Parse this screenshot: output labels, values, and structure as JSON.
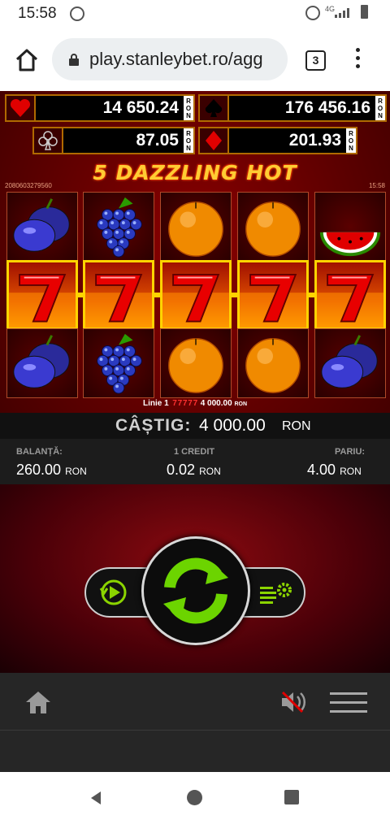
{
  "status_bar": {
    "time": "15:58",
    "network": "4G"
  },
  "browser": {
    "url": "play.stanleybet.ro/agg",
    "tab_count": "3"
  },
  "jackpots": [
    {
      "suit": "heart",
      "value": "14 650.24",
      "currency": "RON",
      "color": "#e00000"
    },
    {
      "suit": "spade",
      "value": "176 456.16",
      "currency": "RON",
      "color": "#000000"
    },
    {
      "suit": "club",
      "value": "87.05",
      "currency": "RON",
      "color": "#000000"
    },
    {
      "suit": "diamond",
      "value": "201.93",
      "currency": "RON",
      "color": "#e00000"
    }
  ],
  "game": {
    "title": "5 DAZZLING HOT",
    "id": "2080603279560",
    "clock": "15:58",
    "reels": [
      [
        "plum",
        "seven",
        "plum"
      ],
      [
        "grapes",
        "seven",
        "grapes"
      ],
      [
        "orange",
        "seven",
        "orange"
      ],
      [
        "orange",
        "seven",
        "orange"
      ],
      [
        "watermelon",
        "seven",
        "plum"
      ]
    ],
    "winning_row": 1
  },
  "win_line": {
    "label": "Linie 1",
    "amount": "4 000.00",
    "currency": "RON"
  },
  "win": {
    "label": "CÂȘTIG:",
    "value": "4 000.00",
    "currency": "RON"
  },
  "info": {
    "balance_label": "BALANȚĂ:",
    "balance_value": "260.00",
    "balance_currency": "RON",
    "credit_label": "1 CREDIT",
    "credit_value": "0.02",
    "credit_currency": "RON",
    "bet_label": "PARIU:",
    "bet_value": "4.00",
    "bet_currency": "RON"
  },
  "colors": {
    "accent_gold": "#ffd400",
    "spin_green": "#6cd400",
    "game_red": "#8a0000"
  },
  "icons": [
    "home-icon",
    "lock-icon",
    "tabs-icon",
    "more-icon",
    "autoplay-icon",
    "spin-icon",
    "settings-icon",
    "sound-muted-icon",
    "hamburger-icon"
  ]
}
